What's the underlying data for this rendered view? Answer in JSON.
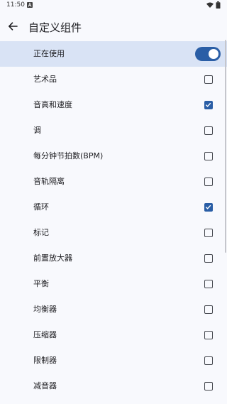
{
  "status_bar": {
    "time": "11:50",
    "notification_icon": "a-app-icon",
    "wifi_icon": "wifi-icon",
    "battery_icon": "battery-icon"
  },
  "app_bar": {
    "back_icon": "arrow-left-icon",
    "title": "自定义组件"
  },
  "master_toggle": {
    "label": "正在使用",
    "on": true
  },
  "components": [
    {
      "label": "艺术品",
      "checked": false
    },
    {
      "label": "音高和速度",
      "checked": true
    },
    {
      "label": "调",
      "checked": false
    },
    {
      "label": "每分钟节拍数(BPM)",
      "checked": false
    },
    {
      "label": "音轨隔离",
      "checked": false
    },
    {
      "label": "循环",
      "checked": true
    },
    {
      "label": "标记",
      "checked": false
    },
    {
      "label": "前置放大器",
      "checked": false
    },
    {
      "label": "平衡",
      "checked": false
    },
    {
      "label": "均衡器",
      "checked": false
    },
    {
      "label": "压缩器",
      "checked": false
    },
    {
      "label": "限制器",
      "checked": false
    },
    {
      "label": "减音器",
      "checked": false
    }
  ],
  "colors": {
    "accent": "#2a5ea6",
    "master_row_bg": "#d9e3f5",
    "page_bg": "#f8f9fd"
  }
}
